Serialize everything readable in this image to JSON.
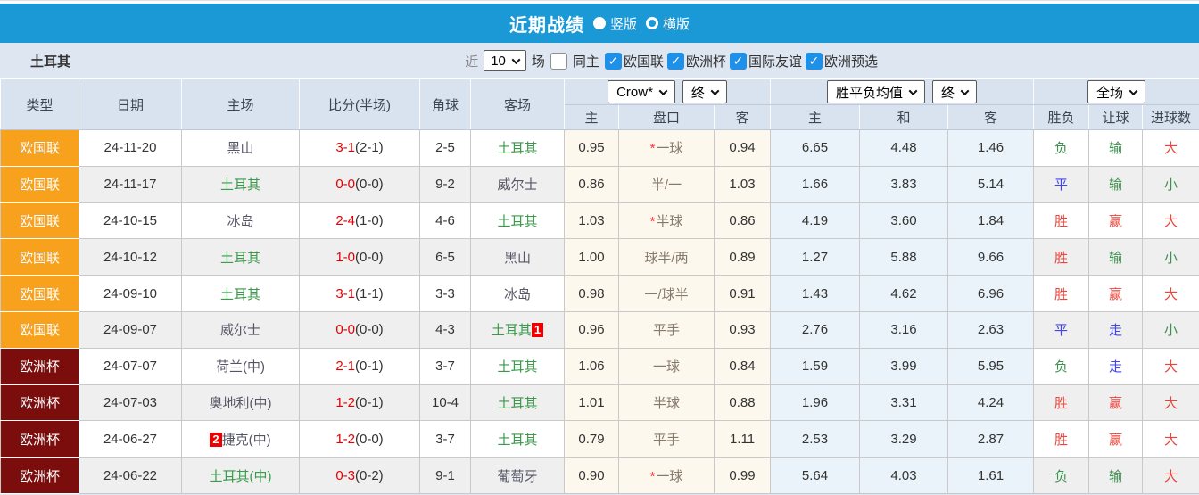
{
  "title_bar": {
    "title": "近期战绩",
    "radio_vertical": "竖版",
    "radio_horizontal": "横版"
  },
  "filter_bar": {
    "team": "土耳其",
    "near_label": "近",
    "count_value": "10",
    "matches_label": "场",
    "same_home": {
      "label": "同主",
      "checked": false
    },
    "leagues": [
      {
        "label": "欧国联",
        "checked": true
      },
      {
        "label": "欧洲杯",
        "checked": true
      },
      {
        "label": "国际友谊",
        "checked": true
      },
      {
        "label": "欧洲预选",
        "checked": true
      }
    ]
  },
  "table": {
    "headers": {
      "type": "类型",
      "date": "日期",
      "home": "主场",
      "score": "比分(半场)",
      "corner": "角球",
      "away": "客场",
      "odds_select": "Crow*",
      "odds_final": "终",
      "avg_select": "胜平负均值",
      "avg_final": "终",
      "fulltime_select": "全场",
      "odds_home": "主",
      "odds_handicap": "盘口",
      "odds_away": "客",
      "avg_home": "主",
      "avg_draw": "和",
      "avg_away": "客",
      "result_wdl": "胜负",
      "result_handicap": "让球",
      "result_goals": "进球数"
    },
    "check_glyph": "✓",
    "rows": [
      {
        "league": "欧国联",
        "league_color": "orange",
        "date": "24-11-20",
        "home": {
          "name": "黑山",
          "highlight": false,
          "badge": null
        },
        "score": {
          "full": "3-1",
          "half": "(2-1)"
        },
        "corner": "2-5",
        "away": {
          "name": "土耳其",
          "highlight": true,
          "badge": null
        },
        "odds_home": "0.95",
        "handicap": {
          "star": true,
          "text": "一球"
        },
        "odds_away": "0.94",
        "avg": [
          "6.65",
          "4.48",
          "1.46"
        ],
        "results": [
          {
            "text": "负",
            "color": "green"
          },
          {
            "text": "输",
            "color": "green"
          },
          {
            "text": "大",
            "color": "red"
          }
        ]
      },
      {
        "league": "欧国联",
        "league_color": "orange",
        "date": "24-11-17",
        "home": {
          "name": "土耳其",
          "highlight": true,
          "badge": null
        },
        "score": {
          "full": "0-0",
          "half": "(0-0)"
        },
        "corner": "9-2",
        "away": {
          "name": "威尔士",
          "highlight": false,
          "badge": null
        },
        "odds_home": "0.86",
        "handicap": {
          "star": false,
          "text": "半/一"
        },
        "odds_away": "1.03",
        "avg": [
          "1.66",
          "3.83",
          "5.14"
        ],
        "results": [
          {
            "text": "平",
            "color": "blue"
          },
          {
            "text": "输",
            "color": "green"
          },
          {
            "text": "小",
            "color": "green"
          }
        ]
      },
      {
        "league": "欧国联",
        "league_color": "orange",
        "date": "24-10-15",
        "home": {
          "name": "冰岛",
          "highlight": false,
          "badge": null
        },
        "score": {
          "full": "2-4",
          "half": "(1-0)"
        },
        "corner": "4-6",
        "away": {
          "name": "土耳其",
          "highlight": true,
          "badge": null
        },
        "odds_home": "1.03",
        "handicap": {
          "star": true,
          "text": "半球"
        },
        "odds_away": "0.86",
        "avg": [
          "4.19",
          "3.60",
          "1.84"
        ],
        "results": [
          {
            "text": "胜",
            "color": "red"
          },
          {
            "text": "赢",
            "color": "red"
          },
          {
            "text": "大",
            "color": "red"
          }
        ]
      },
      {
        "league": "欧国联",
        "league_color": "orange",
        "date": "24-10-12",
        "home": {
          "name": "土耳其",
          "highlight": true,
          "badge": null
        },
        "score": {
          "full": "1-0",
          "half": "(0-0)"
        },
        "corner": "6-5",
        "away": {
          "name": "黑山",
          "highlight": false,
          "badge": null
        },
        "odds_home": "1.00",
        "handicap": {
          "star": false,
          "text": "球半/两"
        },
        "odds_away": "0.89",
        "avg": [
          "1.27",
          "5.88",
          "9.66"
        ],
        "results": [
          {
            "text": "胜",
            "color": "red"
          },
          {
            "text": "输",
            "color": "green"
          },
          {
            "text": "小",
            "color": "green"
          }
        ]
      },
      {
        "league": "欧国联",
        "league_color": "orange",
        "date": "24-09-10",
        "home": {
          "name": "土耳其",
          "highlight": true,
          "badge": null
        },
        "score": {
          "full": "3-1",
          "half": "(1-1)"
        },
        "corner": "3-3",
        "away": {
          "name": "冰岛",
          "highlight": false,
          "badge": null
        },
        "odds_home": "0.98",
        "handicap": {
          "star": false,
          "text": "一/球半"
        },
        "odds_away": "0.91",
        "avg": [
          "1.43",
          "4.62",
          "6.96"
        ],
        "results": [
          {
            "text": "胜",
            "color": "red"
          },
          {
            "text": "赢",
            "color": "red"
          },
          {
            "text": "大",
            "color": "red"
          }
        ]
      },
      {
        "league": "欧国联",
        "league_color": "orange",
        "date": "24-09-07",
        "home": {
          "name": "威尔士",
          "highlight": false,
          "badge": null
        },
        "score": {
          "full": "0-0",
          "half": "(0-0)"
        },
        "corner": "4-3",
        "away": {
          "name": "土耳其",
          "highlight": true,
          "badge": {
            "text": "1",
            "pos": "after"
          }
        },
        "odds_home": "0.96",
        "handicap": {
          "star": false,
          "text": "平手"
        },
        "odds_away": "0.93",
        "avg": [
          "2.76",
          "3.16",
          "2.63"
        ],
        "results": [
          {
            "text": "平",
            "color": "blue"
          },
          {
            "text": "走",
            "color": "blue"
          },
          {
            "text": "小",
            "color": "green"
          }
        ]
      },
      {
        "league": "欧洲杯",
        "league_color": "maroon",
        "date": "24-07-07",
        "home": {
          "name": "荷兰(中)",
          "highlight": false,
          "badge": null
        },
        "score": {
          "full": "2-1",
          "half": "(0-1)"
        },
        "corner": "3-7",
        "away": {
          "name": "土耳其",
          "highlight": true,
          "badge": null
        },
        "odds_home": "1.06",
        "handicap": {
          "star": false,
          "text": "一球"
        },
        "odds_away": "0.84",
        "avg": [
          "1.59",
          "3.99",
          "5.95"
        ],
        "results": [
          {
            "text": "负",
            "color": "green"
          },
          {
            "text": "走",
            "color": "blue"
          },
          {
            "text": "大",
            "color": "red"
          }
        ]
      },
      {
        "league": "欧洲杯",
        "league_color": "maroon",
        "date": "24-07-03",
        "home": {
          "name": "奥地利(中)",
          "highlight": false,
          "badge": null
        },
        "score": {
          "full": "1-2",
          "half": "(0-1)"
        },
        "corner": "10-4",
        "away": {
          "name": "土耳其",
          "highlight": true,
          "badge": null
        },
        "odds_home": "1.01",
        "handicap": {
          "star": false,
          "text": "半球"
        },
        "odds_away": "0.88",
        "avg": [
          "1.96",
          "3.31",
          "4.24"
        ],
        "results": [
          {
            "text": "胜",
            "color": "red"
          },
          {
            "text": "赢",
            "color": "red"
          },
          {
            "text": "大",
            "color": "red"
          }
        ]
      },
      {
        "league": "欧洲杯",
        "league_color": "maroon",
        "date": "24-06-27",
        "home": {
          "name": "捷克(中)",
          "highlight": false,
          "badge": {
            "text": "2",
            "pos": "before"
          }
        },
        "score": {
          "full": "1-2",
          "half": "(0-0)"
        },
        "corner": "3-7",
        "away": {
          "name": "土耳其",
          "highlight": true,
          "badge": null
        },
        "odds_home": "0.79",
        "handicap": {
          "star": false,
          "text": "平手"
        },
        "odds_away": "1.11",
        "avg": [
          "2.53",
          "3.29",
          "2.87"
        ],
        "results": [
          {
            "text": "胜",
            "color": "red"
          },
          {
            "text": "赢",
            "color": "red"
          },
          {
            "text": "大",
            "color": "red"
          }
        ]
      },
      {
        "league": "欧洲杯",
        "league_color": "maroon",
        "date": "24-06-22",
        "home": {
          "name": "土耳其(中)",
          "highlight": true,
          "badge": null
        },
        "score": {
          "full": "0-3",
          "half": "(0-2)"
        },
        "corner": "9-1",
        "away": {
          "name": "葡萄牙",
          "highlight": false,
          "badge": null
        },
        "odds_home": "0.90",
        "handicap": {
          "star": true,
          "text": "一球"
        },
        "odds_away": "0.99",
        "avg": [
          "5.64",
          "4.03",
          "1.61"
        ],
        "results": [
          {
            "text": "负",
            "color": "green"
          },
          {
            "text": "输",
            "color": "green"
          },
          {
            "text": "大",
            "color": "red"
          }
        ]
      }
    ]
  },
  "colors": {
    "topbar_blue": "#1b99d6",
    "league_orange": "#f7a11c",
    "league_maroon": "#7b0d0d",
    "team_highlight_green": "#3a9a4a",
    "score_red": "#e60000",
    "odds_column_bg": "#fdf8ee",
    "avg_column_bg": "#e9f3f9",
    "result_red": "#e8453c",
    "result_blue": "#4444ee",
    "result_green": "#3d9150",
    "checkbox_blue": "#1e90e8",
    "badge_red": "#ee0000"
  }
}
